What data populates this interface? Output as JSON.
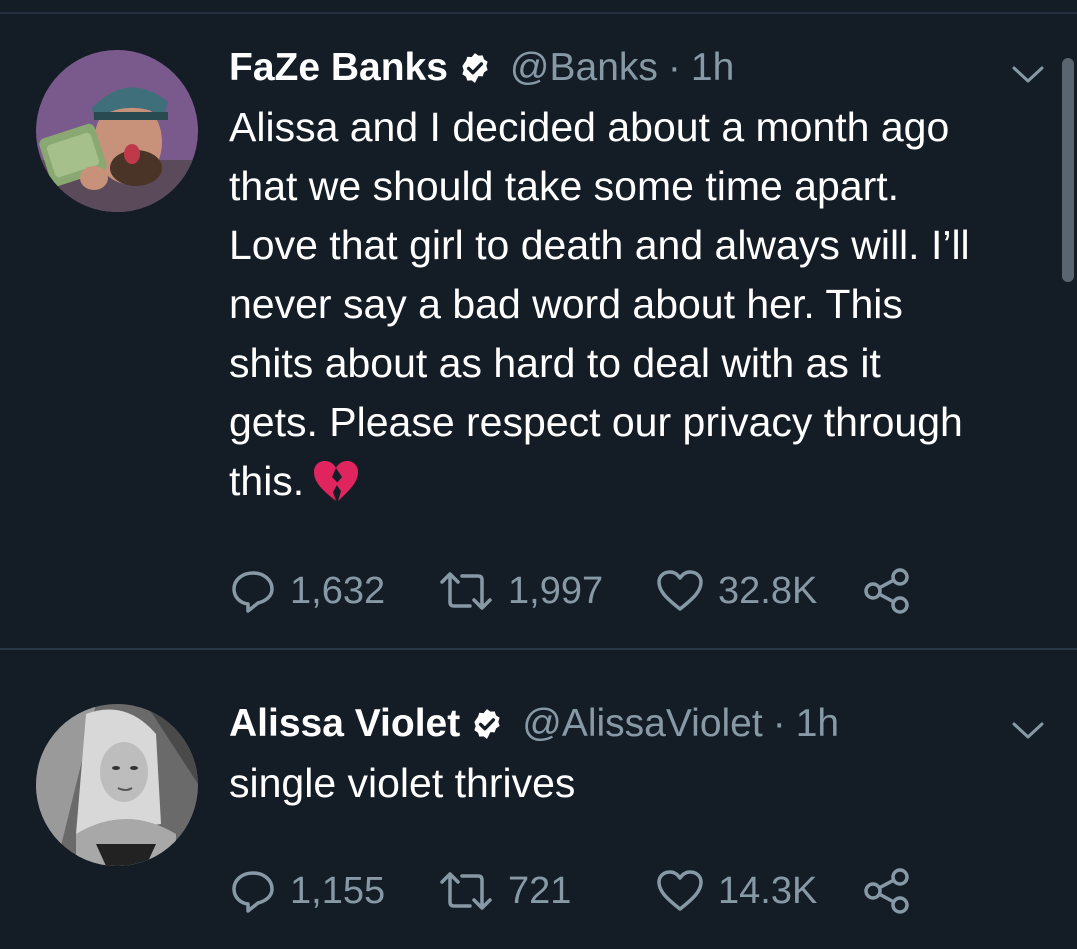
{
  "colors": {
    "background": "#141d26",
    "text": "#ffffff",
    "muted": "#8899a6",
    "divider": "#2a3745",
    "heart_emoji": "#e0245e"
  },
  "tweets": [
    {
      "name": "FaZe Banks",
      "verified_icon": "verified-badge-icon",
      "handle": "@Banks",
      "separator": "·",
      "time": "1h",
      "text_lines": [
        "Alissa and I decided about a month ago",
        "that we should take some time apart.",
        "Love that girl to death and always will. I’ll",
        "never say a bad word about her. This",
        "shits about as hard to deal with as it",
        "gets. Please respect our privacy through",
        "this."
      ],
      "emoji": "broken-heart-icon",
      "replies": "1,632",
      "retweets": "1,997",
      "likes": "32.8K"
    },
    {
      "name": "Alissa Violet",
      "verified_icon": "verified-badge-icon",
      "handle": "@AlissaViolet",
      "separator": "·",
      "time": "1h",
      "text_lines": [
        "single violet thrives"
      ],
      "replies": "1,155",
      "retweets": "721",
      "likes": "14.3K"
    }
  ]
}
